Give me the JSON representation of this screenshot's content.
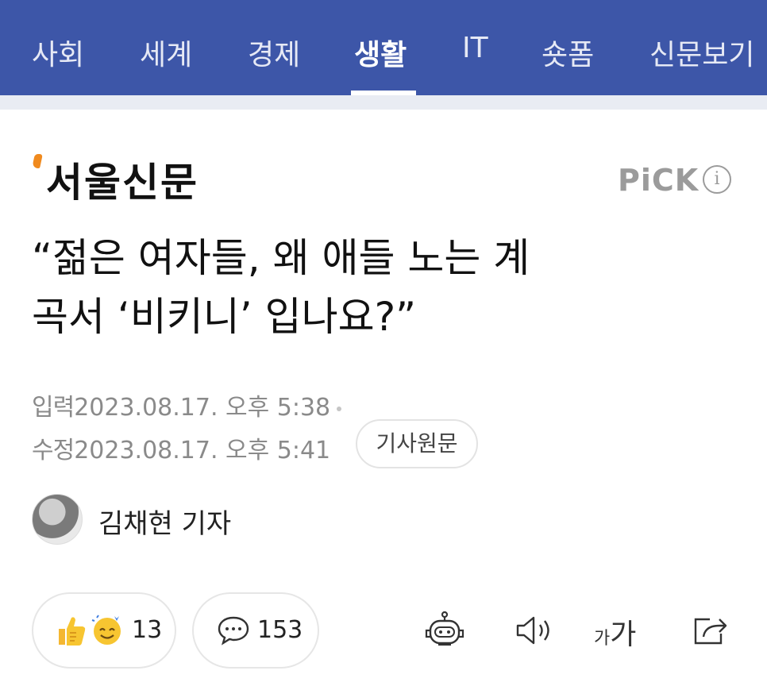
{
  "nav": {
    "items": [
      "사회",
      "세계",
      "경제",
      "생활",
      "IT",
      "숏폼",
      "신문보기"
    ],
    "active_index": 3,
    "background": "#3d56a8"
  },
  "press": {
    "logo_text": "서울신문",
    "pick_label": "PiCK",
    "info_icon": "i",
    "accent": "#f08a1e"
  },
  "article": {
    "headline_line1": "“젊은 여자들, 왜 애들 노는 계",
    "headline_line2": "곡서 ‘비키니’ 입나요?”",
    "published_label": "입력",
    "published_value": "2023.08.17. 오후 5:38",
    "modified_label": "수정",
    "modified_value": "2023.08.17. 오후 5:41",
    "original_button": "기사원문",
    "reporter": "김채현 기자"
  },
  "actions": {
    "reaction_count": "13",
    "comment_count": "153",
    "font_small": "가",
    "font_large": "가",
    "icons": [
      "thumbs-up-icon",
      "smile-face-icon",
      "comment-bubble-icon",
      "robot-summary-icon",
      "speaker-icon",
      "font-size-icon",
      "share-icon"
    ]
  }
}
